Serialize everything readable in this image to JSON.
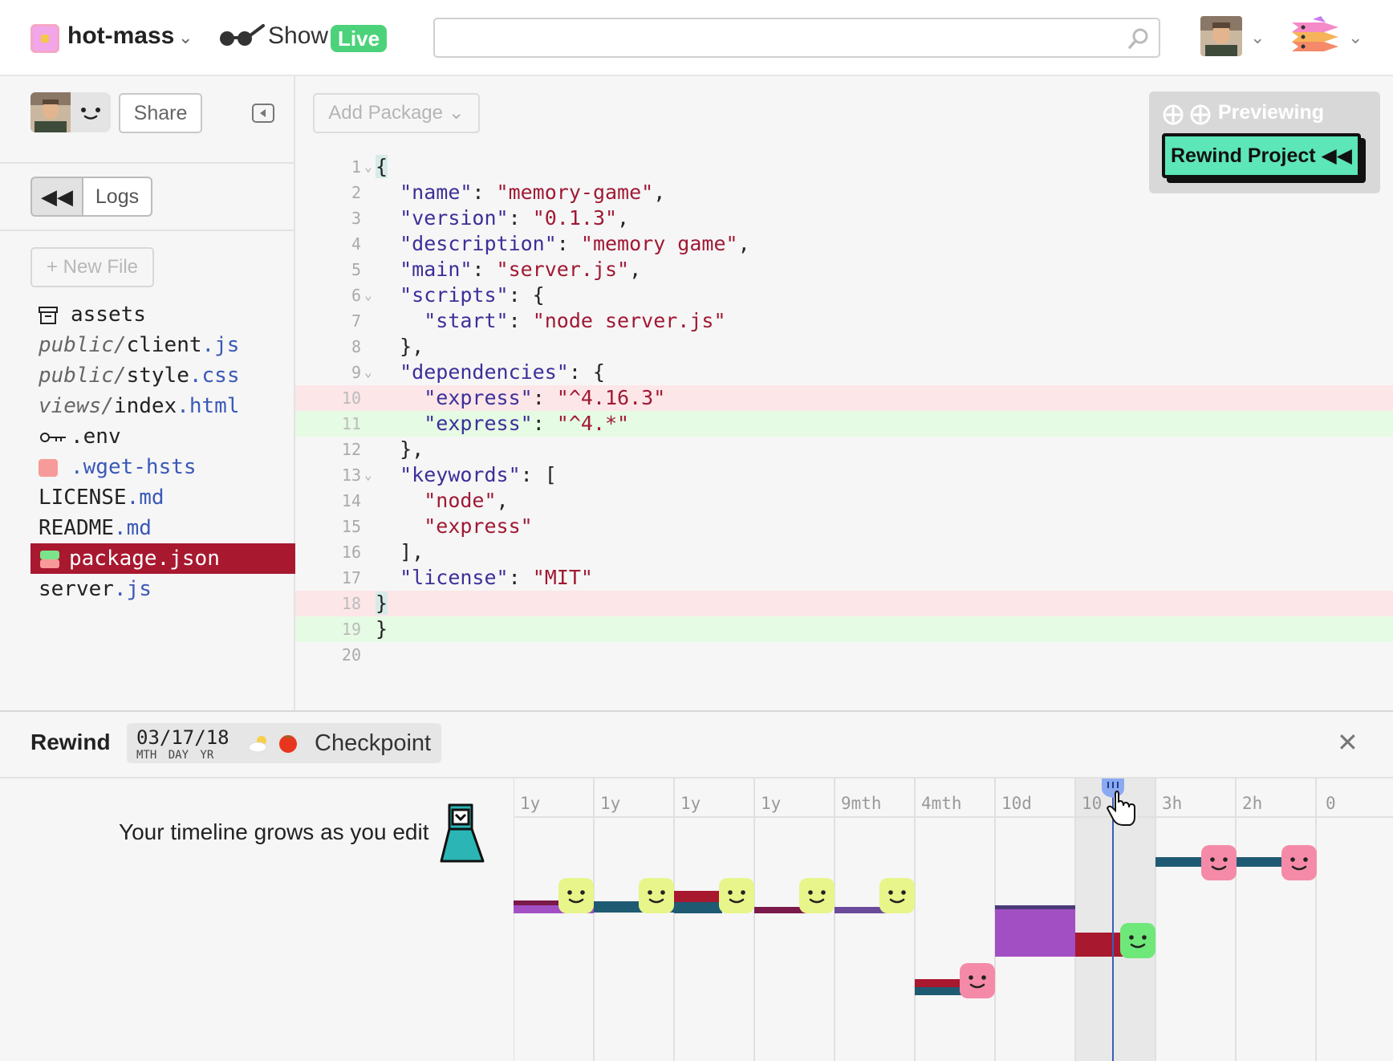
{
  "header": {
    "project_name": "hot-mass",
    "show_label": "Show",
    "live_badge": "Live",
    "search": {
      "value": "",
      "placeholder": ""
    }
  },
  "sidebar": {
    "share_label": "Share",
    "rewind_symbol": "◀◀",
    "logs_label": "Logs",
    "new_file_label": "+ New File",
    "files": [
      {
        "dir": "",
        "name": "assets",
        "ext": "",
        "icon": "archive-icon"
      },
      {
        "dir": "public/",
        "name": "client",
        "ext": ".js"
      },
      {
        "dir": "public/",
        "name": "style",
        "ext": ".css"
      },
      {
        "dir": "views/",
        "name": "index",
        "ext": ".html"
      },
      {
        "dir": "",
        "name": ".env",
        "ext": "",
        "icon": "key-icon"
      },
      {
        "dir": "",
        "name": ".wget-hsts",
        "ext": "",
        "icon": "binary-file-icon"
      },
      {
        "dir": "",
        "name": "LICENSE",
        "ext": ".md"
      },
      {
        "dir": "",
        "name": "README",
        "ext": ".md"
      },
      {
        "dir": "",
        "name": "package",
        "ext": ".json",
        "icon": "diff-file-icon",
        "active": true
      },
      {
        "dir": "",
        "name": "server",
        "ext": ".js"
      }
    ]
  },
  "editor": {
    "add_package_label": "Add Package",
    "lines": [
      {
        "n": "1",
        "fold": true
      },
      {
        "n": "2"
      },
      {
        "n": "3"
      },
      {
        "n": "4"
      },
      {
        "n": "5"
      },
      {
        "n": "6",
        "fold": true
      },
      {
        "n": "7"
      },
      {
        "n": "8"
      },
      {
        "n": "9",
        "fold": true
      },
      {
        "n": "10",
        "diff": "del"
      },
      {
        "n": "11",
        "diff": "add"
      },
      {
        "n": "12"
      },
      {
        "n": "13",
        "fold": true
      },
      {
        "n": "14"
      },
      {
        "n": "15"
      },
      {
        "n": "16"
      },
      {
        "n": "17"
      },
      {
        "n": "18",
        "diff": "del"
      },
      {
        "n": "19",
        "diff": "add"
      },
      {
        "n": "20"
      }
    ],
    "code": {
      "l1": "{",
      "l2k": "\"name\"",
      "l2v": "\"memory-game\"",
      "l3k": "\"version\"",
      "l3v": "\"0.1.3\"",
      "l4k": "\"description\"",
      "l4v": "\"memory game\"",
      "l5k": "\"main\"",
      "l5v": "\"server.js\"",
      "l6k": "\"scripts\"",
      "l7k": "\"start\"",
      "l7v": "\"node server.js\"",
      "l9k": "\"dependencies\"",
      "l10k": "\"express\"",
      "l10v": "\"^4.16.3\"",
      "l11k": "\"express\"",
      "l11v": "\"^4.*\"",
      "l13k": "\"keywords\"",
      "l14v": "\"node\"",
      "l15v": "\"express\"",
      "l17k": "\"license\"",
      "l17v": "\"MIT\"",
      "l18": "}",
      "l19": "}"
    },
    "preview": {
      "label": "Previewing",
      "rewind_project_label": "Rewind Project ◀◀"
    }
  },
  "rewind": {
    "title": "Rewind",
    "date": "03/17/18",
    "date_sub": "MTH DAY YR",
    "checkpoint_label": "Checkpoint",
    "close_symbol": "✕",
    "timeline_message": "Your timeline grows as you edit",
    "columns": [
      "1y",
      "1y",
      "1y",
      "1y",
      "9mth",
      "4mth",
      "10d",
      "10",
      "3h",
      "2h",
      "0"
    ],
    "colors": {
      "yellow_face": "#e8f58a",
      "pink_face": "#f58aa8",
      "green_face": "#6fe87a",
      "purple": "#a34fc4",
      "teal": "#1f5a73",
      "crimson": "#a8182f",
      "scrubber": "#8aa9f0"
    }
  }
}
